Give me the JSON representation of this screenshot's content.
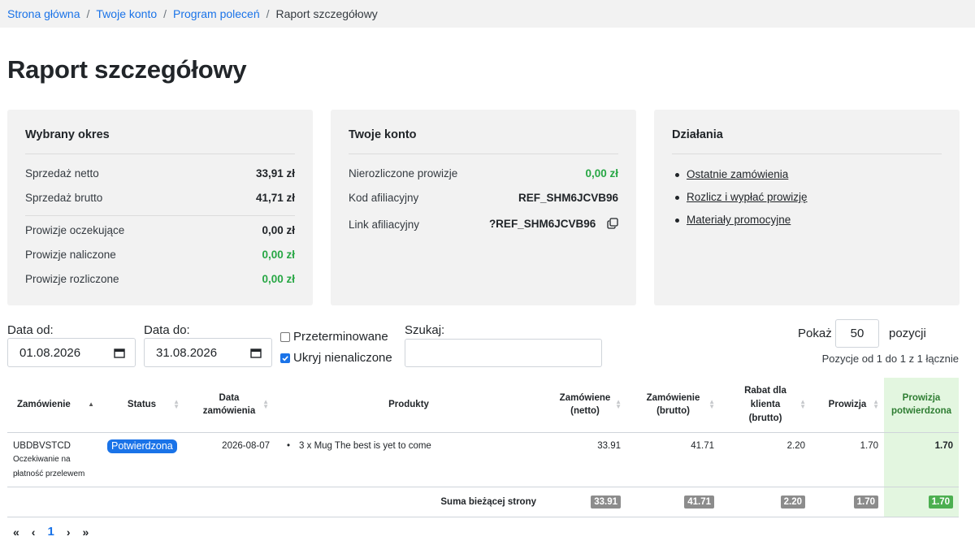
{
  "breadcrumb": {
    "items": [
      "Strona główna",
      "Twoje konto",
      "Program poleceń"
    ],
    "current": "Raport szczegółowy"
  },
  "page_title": "Raport szczegółowy",
  "period": {
    "title": "Wybrany okres",
    "net_sales_label": "Sprzedaż netto",
    "net_sales_value": "33,91 zł",
    "gross_sales_label": "Sprzedaż brutto",
    "gross_sales_value": "41,71 zł",
    "pending_label": "Prowizje oczekujące",
    "pending_value": "0,00 zł",
    "accrued_label": "Prowizje naliczone",
    "accrued_value": "0,00 zł",
    "settled_label": "Prowizje rozliczone",
    "settled_value": "0,00 zł"
  },
  "account": {
    "title": "Twoje konto",
    "unsettled_label": "Nierozliczone prowizje",
    "unsettled_value": "0,00 zł",
    "code_label": "Kod afiliacyjny",
    "code_value": "REF_SHM6JCVB96",
    "link_label": "Link afiliacyjny",
    "link_value": "?REF_SHM6JCVB96",
    "copy_icon": "copy-icon"
  },
  "actions": {
    "title": "Działania",
    "items": [
      "Ostatnie zamówienia",
      "Rozlicz i wypłać prowizję",
      "Materiały promocyjne"
    ]
  },
  "filters": {
    "date_from_label": "Data od:",
    "date_from_value": "01.08.2026",
    "date_to_label": "Data do:",
    "date_to_value": "31.08.2026",
    "overdue_label": "Przeterminowane",
    "overdue_checked": false,
    "hide_unaccrued_label": "Ukryj nienaliczone",
    "hide_unaccrued_checked": true,
    "search_label": "Szukaj:",
    "search_value": "",
    "show_label": "Pokaż",
    "show_value": "50",
    "show_suffix": "pozycji",
    "info": "Pozycje od 1 do 1 z 1 łącznie"
  },
  "table": {
    "headers": {
      "order": "Zamówienie",
      "status": "Status",
      "date": "Data zamówienia",
      "products": "Produkty",
      "net": "Zamówiene (netto)",
      "gross": "Zamówienie (brutto)",
      "discount": "Rabat dla klienta (brutto)",
      "commission": "Prowizja",
      "confirmed": "Prowizja potwierdzona"
    },
    "rows": [
      {
        "order": "UBDBVSTCD",
        "order_note": "Oczekiwanie na płatność przelewem",
        "status": "Potwierdzona",
        "date": "2026-08-07",
        "product": "3 x Mug The best is yet to come",
        "net": "33.91",
        "gross": "41.71",
        "discount": "2.20",
        "commission": "1.70",
        "confirmed": "1.70"
      }
    ],
    "footer": {
      "label": "Suma bieżącej strony",
      "net": "33.91",
      "gross": "41.71",
      "discount": "2.20",
      "commission": "1.70",
      "confirmed": "1.70"
    }
  },
  "pagination": {
    "first": "«",
    "prev": "‹",
    "current": "1",
    "next": "›",
    "last": "»"
  },
  "colors": {
    "link": "#1a73e8",
    "green": "#28a745",
    "card_bg": "#f2f2f2",
    "highlight_col": "#e3f6e0"
  }
}
